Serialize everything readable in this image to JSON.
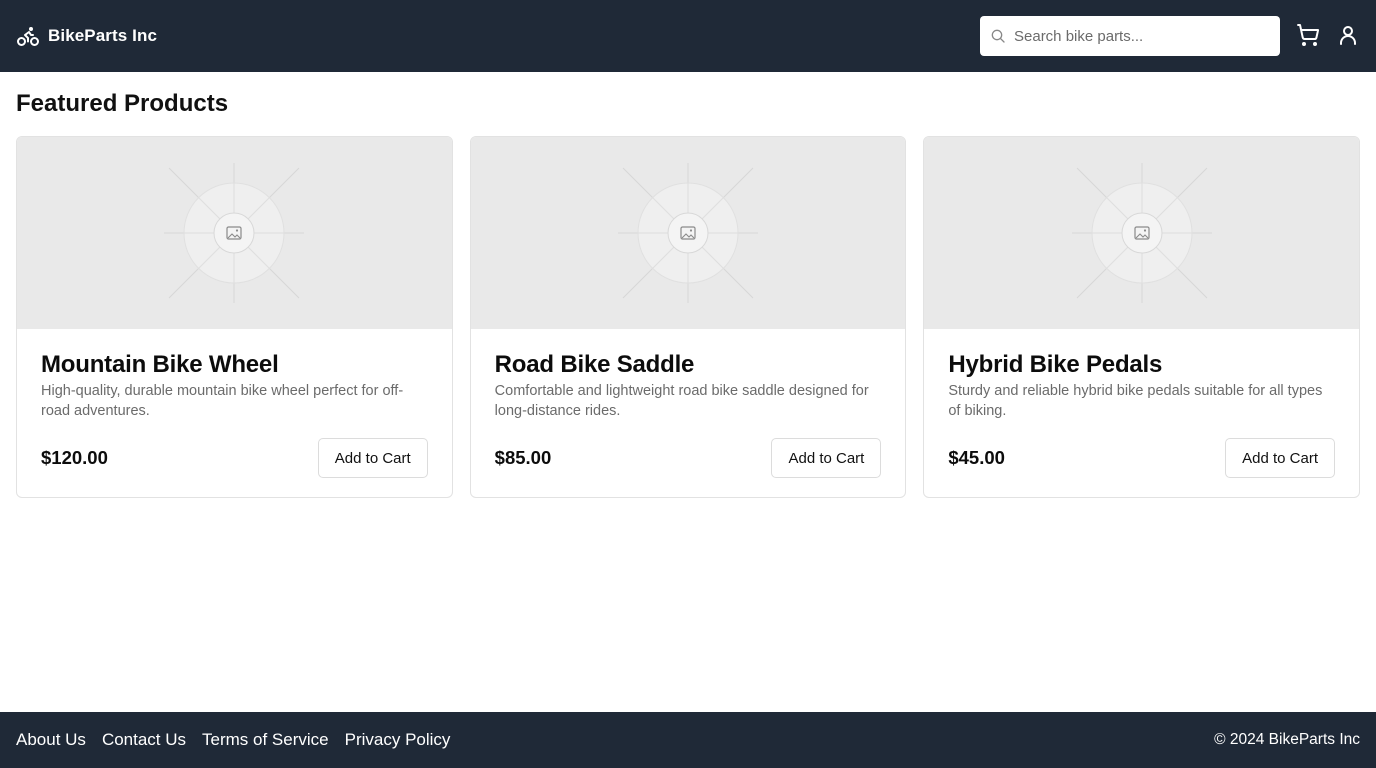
{
  "header": {
    "brand": "BikeParts Inc",
    "brand_icon": "bicycle-icon",
    "search": {
      "placeholder": "Search bike parts...",
      "value": "",
      "icon": "search-icon"
    },
    "cart_icon": "cart-icon",
    "user_icon": "user-icon",
    "background": "#1f2937"
  },
  "main": {
    "title": "Featured Products",
    "products": [
      {
        "name": "Mountain Bike Wheel",
        "description": "High-quality, durable mountain bike wheel perfect for off-road adventures.",
        "price": "$120.00",
        "button": "Add to Cart",
        "image_icon": "image-placeholder-icon"
      },
      {
        "name": "Road Bike Saddle",
        "description": "Comfortable and lightweight road bike saddle designed for long-distance rides.",
        "price": "$85.00",
        "button": "Add to Cart",
        "image_icon": "image-placeholder-icon"
      },
      {
        "name": "Hybrid Bike Pedals",
        "description": "Sturdy and reliable hybrid bike pedals suitable for all types of biking.",
        "price": "$45.00",
        "button": "Add to Cart",
        "image_icon": "image-placeholder-icon"
      }
    ]
  },
  "footer": {
    "links": [
      "About Us",
      "Contact Us",
      "Terms of Service",
      "Privacy Policy"
    ],
    "copyright": "© 2024 BikeParts Inc",
    "background": "#1f2937"
  }
}
